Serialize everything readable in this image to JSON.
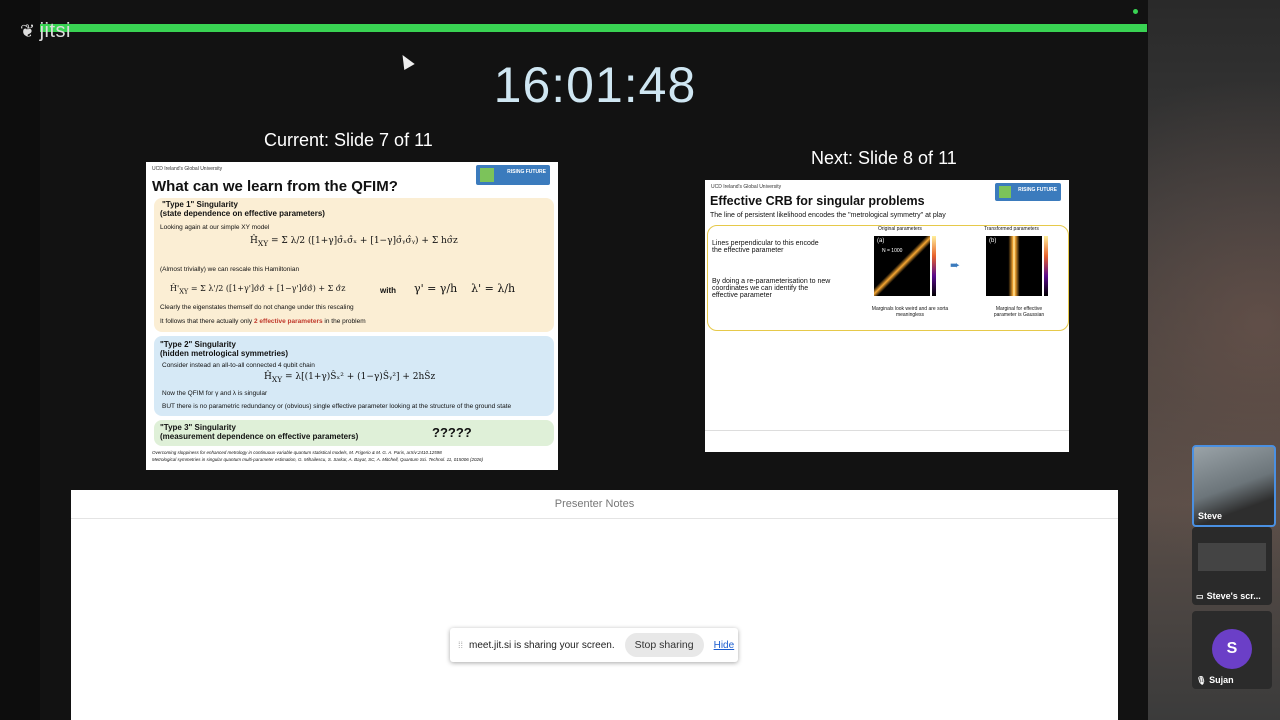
{
  "app": {
    "logo_text": "jitsi"
  },
  "clock": "16:01:48",
  "current": {
    "heading": "Current: Slide 7 of 11",
    "university": "UCD Ireland's Global University",
    "badge": "RISING FUTURE",
    "title": "What can we learn from the QFIM?",
    "type1_title": "\"Type 1\" Singularity",
    "type1_sub": "(state dependence on effective parameters)",
    "line1": "Looking again at our simple XY model",
    "line2": "(Almost trivially) we can rescale this Hamiltonian",
    "with": "with",
    "line3": "Clearly the eigenstates themself do not change under this rescaling",
    "line4_a": "It follows that there actually only",
    "line4_b": "2 effective parameters",
    "line4_c": "in the problem",
    "type2_title": "\"Type 2\" Singularity",
    "type2_sub": "(hidden metrological symmetries)",
    "line5": "Consider instead an all-to-all connected 4 qubit chain",
    "line6": "Now the QFIM for γ and λ is singular",
    "line7": "BUT there is no parametric redundancy or (obvious) single effective parameter looking at the structure of the ground state",
    "type3_title": "\"Type 3\" Singularity",
    "type3_sub": "(measurement dependence on effective parameters)",
    "qmarks": "?????",
    "ref1": "Overcoming sloppiness for enhanced metrology in continuous-variable quantum statistical models, M. Frigerio & M. G. A. Paris, arXiv:2410.12598",
    "ref2": "Metrological symmetries in singular quantum multi-parameter estimation, G. Mihailescu, S. Sarkar, A. Bayat, SC, A. Mitchell, Quantum Sci. Technol. 11, 015006 (2026)"
  },
  "next": {
    "heading": "Next: Slide 8 of 11",
    "university": "UCD Ireland's Global University",
    "badge": "RISING FUTURE",
    "title": "Effective CRB for singular problems",
    "subtitle": "The line of persistent likelihood encodes the \"metrological symmetry\" at play",
    "p1": "Lines perpendicular to this encode the effective parameter",
    "p2": "By doing a re-parameterisation to new coordinates we can identify the effective parameter",
    "plot_a_title": "Original parameters",
    "plot_b_title": "Transformed parameters",
    "plot_a_label": "(a)",
    "plot_a_n": "N = 1000",
    "plot_b_label": "(b)",
    "cap_a": "Marginals look weird and are sorta meaningless",
    "cap_b": "Marginal for effective parameter is Gaussian"
  },
  "notes": {
    "header": "Presenter Notes"
  },
  "share_bar": {
    "message": "meet.jit.si is sharing your screen.",
    "stop_label": "Stop sharing",
    "hide_label": "Hide"
  },
  "participants": [
    {
      "name": "Steve"
    },
    {
      "name": "Steve's scr..."
    },
    {
      "name": "Sujan",
      "initial": "S"
    }
  ],
  "colors": {
    "progress": "#39d353",
    "avatar": "#6b3fc7",
    "accent_red": "#c0392b"
  }
}
